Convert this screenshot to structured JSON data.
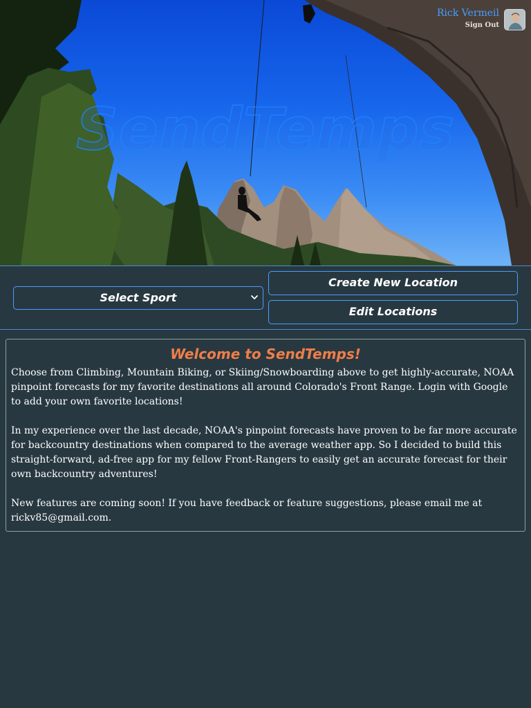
{
  "hero": {
    "title": "SendTemps",
    "user_name": "Rick Vermeil",
    "sign_out": "Sign Out",
    "avatar_icon": "user-avatar",
    "colors": {
      "sky": "#1766ec",
      "title_outline": "#1e82ff"
    }
  },
  "controls": {
    "sport_select": {
      "selected": "Select Sport",
      "icon": "chevron-down-icon"
    },
    "create_location_label": "Create New Location",
    "edit_locations_label": "Edit Locations"
  },
  "welcome": {
    "title": "Welcome to SendTemps!",
    "paragraph_1": "Choose from Climbing, Mountain Biking, or Skiing/Snowboarding above to get highly-accurate, NOAA pinpoint forecasts for my favorite destinations all around Colorado's Front Range. Login with Google to add your own favorite locations!",
    "paragraph_2": "In my experience over the last decade, NOAA's pinpoint forecasts have proven to be far more accurate for backcountry destinations when compared to the average weather app. So I decided to build this straight-forward, ad-free app for my fellow Front-Rangers to easily get an accurate forecast for their own backcountry adventures!",
    "paragraph_3": "New features are coming soon! If you have feedback or feature suggestions, please email me at rickv85@gmail.com."
  },
  "theme": {
    "background": "#283841",
    "accent": "#4a9eff",
    "title_color": "#f07e48"
  }
}
